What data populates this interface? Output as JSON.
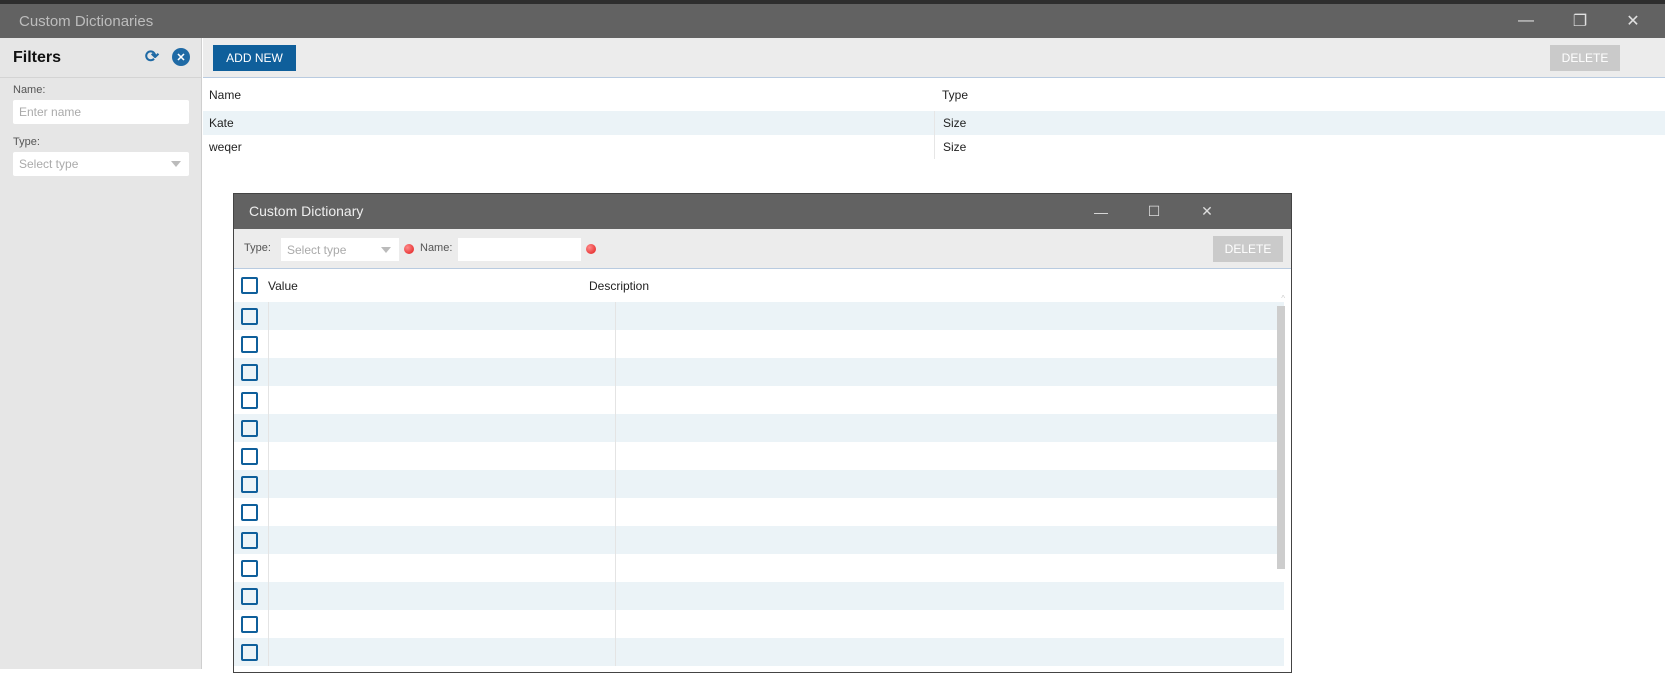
{
  "window": {
    "title": "Custom Dictionaries",
    "minimize": "—",
    "restore": "❐",
    "close": "✕"
  },
  "filters": {
    "title": "Filters",
    "name_label": "Name:",
    "name_placeholder": "Enter name",
    "type_label": "Type:",
    "type_placeholder": "Select type"
  },
  "toolbar": {
    "add_new": "ADD NEW",
    "delete": "DELETE"
  },
  "grid": {
    "columns": [
      "Name",
      "Type"
    ],
    "rows": [
      {
        "name": "Kate",
        "type": "Size"
      },
      {
        "name": "weqer",
        "type": "Size"
      }
    ]
  },
  "dialog": {
    "title": "Custom Dictionary",
    "minimize": "—",
    "maximize": "☐",
    "close": "✕",
    "type_label": "Type:",
    "type_placeholder": "Select type",
    "name_label": "Name:",
    "name_value": "",
    "delete": "DELETE",
    "columns": [
      "Value",
      "Description"
    ],
    "row_count": 13
  },
  "colors": {
    "accent": "#0f5f9b",
    "titlebar": "#626262",
    "row_alt": "#ebf3f7",
    "required": "#e01818"
  }
}
